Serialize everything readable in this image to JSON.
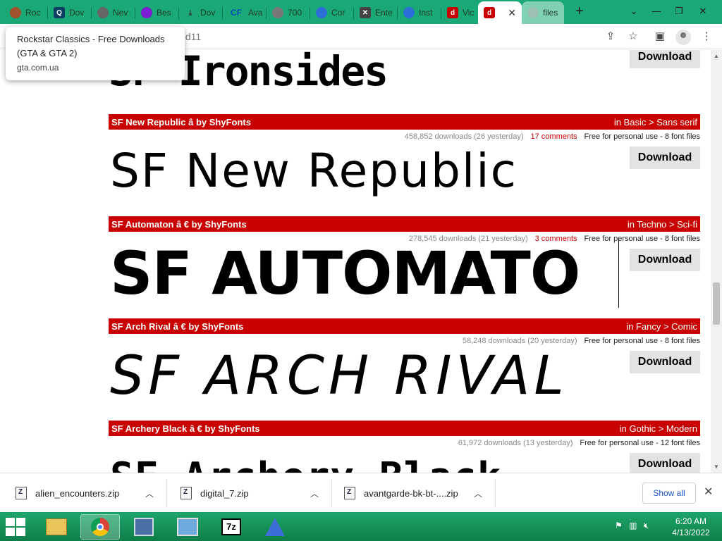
{
  "tabs": [
    {
      "label": "Roc",
      "icon": "person-avatar-icon"
    },
    {
      "label": "Dov",
      "icon": "search-icon"
    },
    {
      "label": "Nev",
      "icon": "globe-icon"
    },
    {
      "label": "Bes",
      "icon": "purple-app-icon"
    },
    {
      "label": "Dov",
      "icon": "download-icon"
    },
    {
      "label": "Ava",
      "icon": "cf-icon",
      "icon_text": "CF"
    },
    {
      "label": "700",
      "icon": "globe-icon"
    },
    {
      "label": "Cor",
      "icon": "bird-icon"
    },
    {
      "label": "Ente",
      "icon": "x-box-icon"
    },
    {
      "label": "Inst",
      "icon": "bird-icon"
    },
    {
      "label": "Vic",
      "icon": "red-logo-icon"
    },
    {
      "label": "",
      "icon": "red-logo-icon",
      "active": true
    },
    {
      "label": "files",
      "icon": "loading-icon"
    }
  ],
  "tooltip": {
    "title": "Rockstar Classics - Free Downloads (GTA & GTA 2)",
    "domain": "gta.com.ua"
  },
  "address": {
    "fragment": "s.d11"
  },
  "top_entry": {
    "preview": "SF Ironsides",
    "download_label": "Download"
  },
  "fonts": [
    {
      "name": "SF New Republic",
      "badges": "â",
      "author": "by ShyFonts",
      "category": "in Basic > Sans serif",
      "downloads": "458,852 downloads (26 yesterday)",
      "comments": "17 comments",
      "license": "Free for personal use - 8 font files",
      "preview": "SF New Republic",
      "download_label": "Download"
    },
    {
      "name": "SF Automaton",
      "badges": "â €",
      "author": "by ShyFonts",
      "category": "in Techno > Sci-fi",
      "downloads": "278,545 downloads (21 yesterday)",
      "comments": "3 comments",
      "license": "Free for personal use - 8 font files",
      "preview": "SF AUTOMATO",
      "download_label": "Download"
    },
    {
      "name": "SF Arch Rival",
      "badges": "â €",
      "author": "by ShyFonts",
      "category": "in Fancy > Comic",
      "downloads": "58,248 downloads (20 yesterday)",
      "comments": "",
      "license": "Free for personal use - 8 font files",
      "preview": "SF ARCH RIVAL",
      "download_label": "Download"
    },
    {
      "name": "SF Archery Black",
      "badges": "â €",
      "author": "by ShyFonts",
      "category": "in Gothic > Modern",
      "downloads": "61,972 downloads (13 yesterday)",
      "comments": "",
      "license": "Free for personal use - 12 font files",
      "preview": "SF Archery Black",
      "download_label": "Download"
    }
  ],
  "downloads_bar": {
    "items": [
      "alien_encounters.zip",
      "digital_7.zip",
      "avantgarde-bk-bt-....zip"
    ],
    "show_all": "Show all"
  },
  "taskbar": {
    "time": "6:20 AM",
    "date": "4/13/2022"
  }
}
